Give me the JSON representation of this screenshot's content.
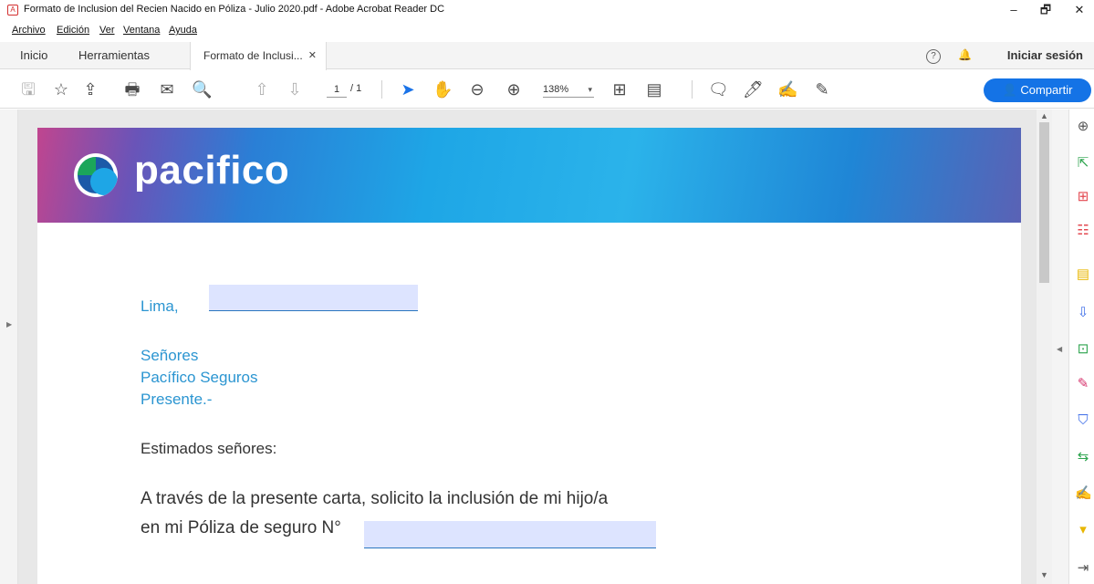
{
  "window": {
    "title": "Formato de Inclusion del Recien Nacido en Póliza - Julio 2020.pdf - Adobe Acrobat Reader DC",
    "app_icon": "pdf-icon",
    "controls": {
      "minimize": "–",
      "maximize": "🗗",
      "close": "✕"
    }
  },
  "menu": [
    "Archivo",
    "Edición",
    "Ver",
    "Ventana",
    "Ayuda"
  ],
  "tabs": {
    "home": "Inicio",
    "tools": "Herramientas",
    "document": "Formato de Inclusi...",
    "close_glyph": "✕"
  },
  "header": {
    "help_icon": "?",
    "bell_icon": "🔔",
    "login": "Iniciar sesión"
  },
  "toolbar": {
    "page_current": "1",
    "page_total": "/ 1",
    "zoom": "138%",
    "zoom_caret": "▾",
    "share_label": "Compartir",
    "icons": {
      "save": "🖫",
      "bookmark": "☆",
      "upload": "⇪",
      "print": "🖶",
      "email": "✉",
      "search": "🔍",
      "prev_page": "⇧",
      "next_page": "⇩",
      "select": "➤",
      "hand": "✋",
      "zoom_out": "⊖",
      "zoom_in": "⊕",
      "fit": "⊞",
      "read": "▤",
      "comment": "🗨",
      "highlight": "🖊",
      "sign": "✍",
      "fill": "✎"
    }
  },
  "document": {
    "brand": "pacifico",
    "lines": {
      "city": "Lima,",
      "greeting1": "Señores",
      "greeting2": "Pacífico Seguros",
      "greeting3": "Presente.-",
      "salutation": "Estimados señores:",
      "body1": "A través de la presente carta, solicito la inclusión de mi hijo/a",
      "body2": "en mi Póliza de seguro N°"
    },
    "fields": {
      "date": "",
      "policy_number": ""
    }
  },
  "scroll": {
    "up": "▲",
    "down": "▼"
  },
  "panels": {
    "left_toggle": "▶",
    "right_toggle": "◀"
  },
  "right_tools": [
    {
      "name": "zoom-tool-icon",
      "glyph": "⊕",
      "color": "#555555"
    },
    {
      "name": "export-pdf-icon",
      "glyph": "⇱",
      "color": "#2da44e"
    },
    {
      "name": "create-pdf-icon",
      "glyph": "⊞",
      "color": "#e34850"
    },
    {
      "name": "organize-pages-icon",
      "glyph": "☷",
      "color": "#e34850"
    },
    {
      "name": "comment-icon",
      "glyph": "▤",
      "color": "#e8b600"
    },
    {
      "name": "scan-icon",
      "glyph": "⇩",
      "color": "#3d6de8"
    },
    {
      "name": "compare-icon",
      "glyph": "⊡",
      "color": "#2da44e"
    },
    {
      "name": "fill-sign-icon",
      "glyph": "✎",
      "color": "#d6336c"
    },
    {
      "name": "protect-icon",
      "glyph": "⛉",
      "color": "#3d6de8"
    },
    {
      "name": "send-for-comments-icon",
      "glyph": "⇆",
      "color": "#2da44e"
    },
    {
      "name": "signature-icon",
      "glyph": "✍",
      "color": "#6f42c1"
    },
    {
      "name": "more-tools-icon",
      "glyph": "▾",
      "color": "#e8b600"
    },
    {
      "name": "collapse-pane-icon",
      "glyph": "⇥",
      "color": "#555555"
    }
  ]
}
